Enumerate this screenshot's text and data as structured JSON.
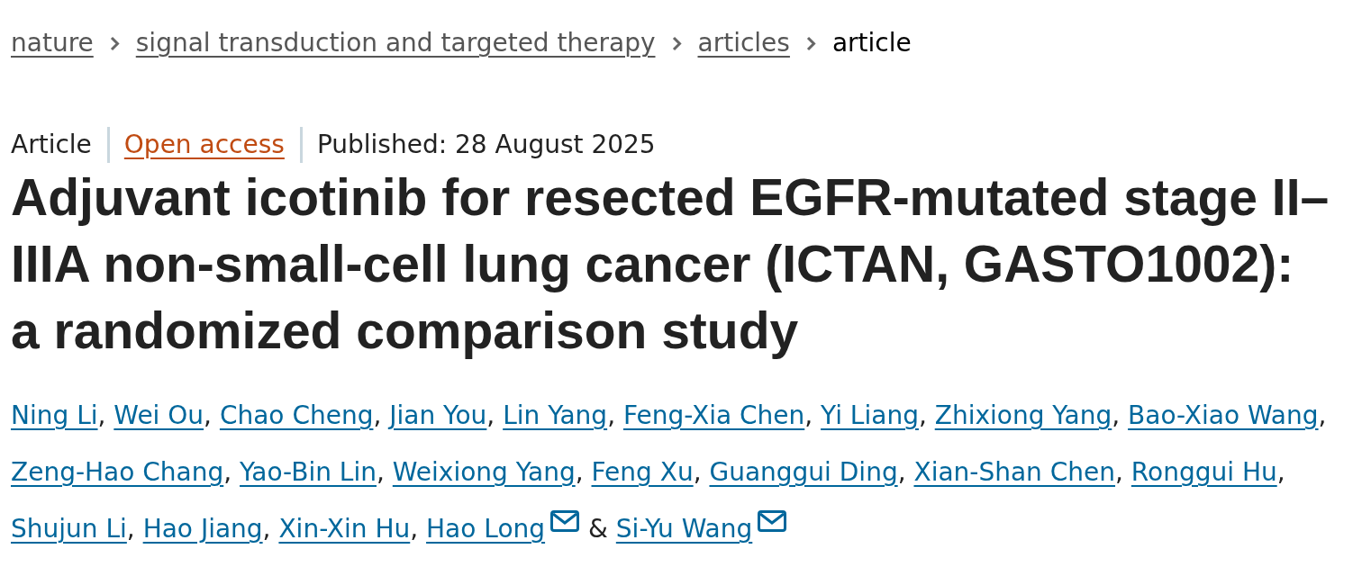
{
  "breadcrumbs": [
    {
      "label": "nature",
      "current": false
    },
    {
      "label": "signal transduction and targeted therapy",
      "current": false
    },
    {
      "label": "articles",
      "current": false
    },
    {
      "label": "article",
      "current": true
    }
  ],
  "article_info": {
    "type": "Article",
    "access": "Open access",
    "published": "Published: 28 August 2025"
  },
  "title": "Adjuvant icotinib for resected EGFR-mutated stage II–IIIA non-small-cell lung cancer (ICTAN, GASTO1002): a randomized comparison study",
  "authors": [
    {
      "name": "Ning Li",
      "corresponding": false,
      "separator": ","
    },
    {
      "name": "Wei Ou",
      "corresponding": false,
      "separator": ","
    },
    {
      "name": "Chao Cheng",
      "corresponding": false,
      "separator": ","
    },
    {
      "name": "Jian You",
      "corresponding": false,
      "separator": ","
    },
    {
      "name": "Lin Yang",
      "corresponding": false,
      "separator": ","
    },
    {
      "name": "Feng-Xia Chen",
      "corresponding": false,
      "separator": ","
    },
    {
      "name": "Yi Liang",
      "corresponding": false,
      "separator": ","
    },
    {
      "name": "Zhixiong Yang",
      "corresponding": false,
      "separator": ","
    },
    {
      "name": "Bao-Xiao Wang",
      "corresponding": false,
      "separator": ","
    },
    {
      "name": "Zeng-Hao Chang",
      "corresponding": false,
      "separator": ","
    },
    {
      "name": "Yao-Bin Lin",
      "corresponding": false,
      "separator": ","
    },
    {
      "name": "Weixiong Yang",
      "corresponding": false,
      "separator": ","
    },
    {
      "name": "Feng Xu",
      "corresponding": false,
      "separator": ","
    },
    {
      "name": "Guanggui Ding",
      "corresponding": false,
      "separator": ","
    },
    {
      "name": "Xian-Shan Chen",
      "corresponding": false,
      "separator": ","
    },
    {
      "name": "Ronggui Hu",
      "corresponding": false,
      "separator": ","
    },
    {
      "name": "Shujun Li",
      "corresponding": false,
      "separator": ","
    },
    {
      "name": "Hao Jiang",
      "corresponding": false,
      "separator": ","
    },
    {
      "name": "Xin-Xin Hu",
      "corresponding": false,
      "separator": ","
    },
    {
      "name": "Hao Long",
      "corresponding": true,
      "separator": "&"
    },
    {
      "name": "Si-Yu Wang",
      "corresponding": true
    }
  ]
}
